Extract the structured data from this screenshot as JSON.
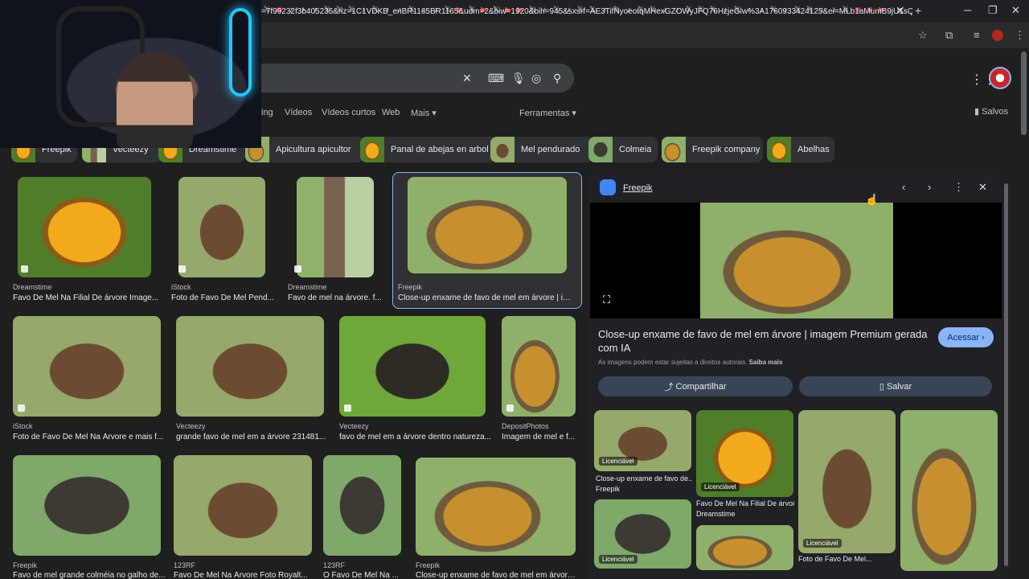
{
  "browser": {
    "url": "=7f99232f3b405235&rlz=1C1VDKB_enBR1165BR1165&udm=2&biw=1920&bih=945&sxsrf=AE3TifNyoeotqMHexGZOWyJFQ76HzjeGlw%3A1760933424125&ei=MLb1aMumB9jU1sQP_rCYsQQ&v...",
    "tab_close": "✕",
    "new_tab": "+"
  },
  "nav": {
    "tabs": [
      "ing",
      "Vídeos",
      "Vídeos curtos",
      "Web",
      "Mais ▾",
      "Ferramentas ▾"
    ],
    "saved": "Salvos"
  },
  "chips": [
    "Freepik",
    "Vecteezy",
    "Dreamstime",
    "Apicultura apicultor",
    "Panal de abejas en arbol",
    "Mel pendurado",
    "Colmeia",
    "Freepik company",
    "Abelhas"
  ],
  "results": [
    {
      "source": "Dreamstime",
      "title": "Favo De Mel Na Filial De árvore Image..."
    },
    {
      "source": "iStock",
      "title": "Foto de Favo De Mel Pend..."
    },
    {
      "source": "Dreamstime",
      "title": "Favo de mel na árvore. f..."
    },
    {
      "source": "Freepik",
      "title": "Close-up enxame de favo de mel em árvore | ima..."
    },
    {
      "source": "iStock",
      "title": "Foto de Favo De Mel Na Árvore e mais f..."
    },
    {
      "source": "Vecteezy",
      "title": "grande favo de mel em a árvore 231481..."
    },
    {
      "source": "Vecteezy",
      "title": "favo de mel em a árvore dentro natureza..."
    },
    {
      "source": "DepositPhotos",
      "title": "Imagem de mel e f..."
    },
    {
      "source": "Freepik",
      "title": "Favo de mel grande colméia no galho de..."
    },
    {
      "source": "123RF",
      "title": "Favo De Mel Na Árvore Foto Royalt..."
    },
    {
      "source": "123RF",
      "title": "O Favo De Mel Na ..."
    },
    {
      "source": "Freepik",
      "title": "Close-up enxame de favo de mel em árvore ..."
    }
  ],
  "panel": {
    "source": "Freepik",
    "title": "Close-up enxame de favo de mel em árvore | imagem Premium gerada com IA",
    "access": "Acessar ›",
    "copyright": "As imagens podem estar sujeitas a direitos autorais.",
    "learn_more": "Saiba mais",
    "share": "Compartilhar",
    "save": "Salvar",
    "licensed": "Licenciável",
    "related": [
      {
        "title": "Close-up enxame de favo de...",
        "source": "Freepik"
      },
      {
        "title": "Favo De Mel Na Filial De árvor...",
        "source": "Dreamstime"
      },
      {
        "title": "Foto de Favo De Mel...",
        "source": ""
      }
    ]
  }
}
